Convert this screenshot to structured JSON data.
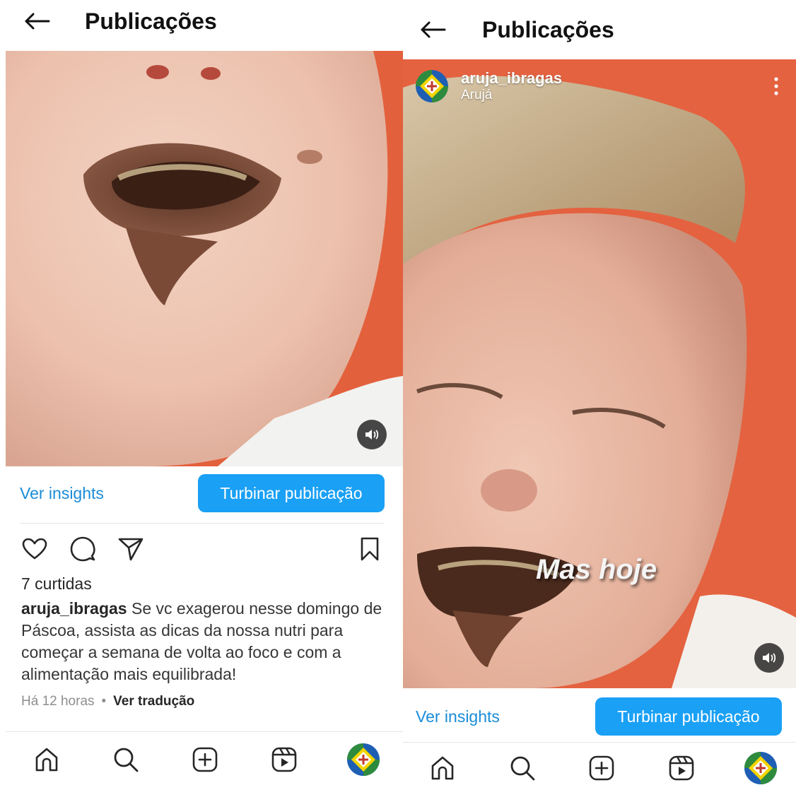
{
  "left_screen": {
    "header": {
      "title": "Publicações"
    },
    "post": {
      "insights_label": "Ver insights",
      "boost_label": "Turbinar publicação",
      "likes": "7 curtidas",
      "caption_user": "aruja_ibragas",
      "caption_text": "Se vc exagerou nesse domingo de Páscoa, assista as dicas da nossa nutri para começar a semana de volta ao foco e com a alimentação mais equilibrada!",
      "time": "Há 12 horas",
      "separator": "•",
      "translate_label": "Ver tradução"
    },
    "nav": [
      "home-icon",
      "search-icon",
      "create-icon",
      "reels-icon",
      "profile-avatar"
    ]
  },
  "right_screen": {
    "header": {
      "title": "Publicações"
    },
    "post": {
      "username": "aruja_ibragas",
      "location": "Arujá",
      "overlay_text": "Mas hoje",
      "insights_label": "Ver insights",
      "boost_label": "Turbinar publicação"
    },
    "nav": [
      "home-icon",
      "search-icon",
      "create-icon",
      "reels-icon",
      "profile-avatar"
    ]
  },
  "colors": {
    "accent": "#1aa0f5",
    "link": "#1a8cd8",
    "background_orange": "#e5603e",
    "text": "#262626",
    "muted": "#8e8e8e"
  }
}
